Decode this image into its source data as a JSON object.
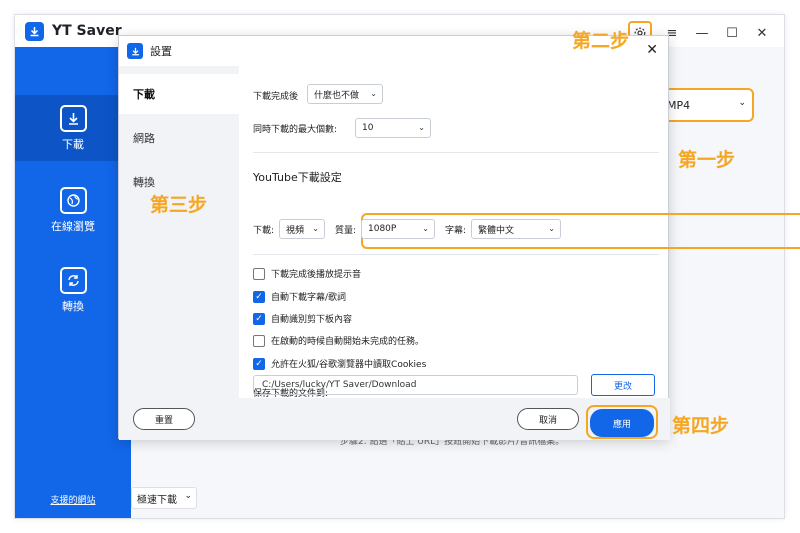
{
  "app": {
    "title": "YT Saver"
  },
  "sidebar": {
    "items": [
      {
        "label": "下載",
        "icon": "download-icon"
      },
      {
        "label": "在線瀏覽",
        "icon": "globe-icon"
      },
      {
        "label": "轉換",
        "icon": "convert-icon"
      }
    ],
    "link_label": "支援的網站"
  },
  "main": {
    "format_value": "MP4",
    "speed_value": "極速下載",
    "hint": "步驟2. 點選「貼上 URL」按鈕開始下載影片/音訊檔案。"
  },
  "dialog": {
    "title": "設置",
    "nav": [
      "下載",
      "網路",
      "轉換"
    ],
    "after_complete_label": "下載完成後",
    "after_complete_value": "什麼也不做",
    "max_label": "同時下載的最大個數:",
    "max_value": "10",
    "youtube_title": "YouTube下載設定",
    "download_label": "下載:",
    "download_value": "視頻",
    "quality_label": "質量:",
    "quality_value": "1080P",
    "subtitle_label": "字幕:",
    "subtitle_value": "繁體中文",
    "checks": [
      {
        "label": "下載完成後播放提示音",
        "checked": false
      },
      {
        "label": "自動下載字幕/歌詞",
        "checked": true
      },
      {
        "label": "自動識別剪下板內容",
        "checked": true
      },
      {
        "label": "在啟動的時候自動開始未完成的任務。",
        "checked": false
      },
      {
        "label": "允許在火狐/谷歌瀏覽器中讀取Cookies",
        "checked": true
      }
    ],
    "save_label": "保存下載的文件到:",
    "save_path": "C:/Users/lucky/YT Saver/Download",
    "change_label": "更改",
    "reset_label": "重置",
    "cancel_label": "取消",
    "apply_label": "應用"
  },
  "annotations": {
    "step1": "第一步",
    "step2": "第二步",
    "step3": "第三步",
    "step4": "第四步"
  },
  "colors": {
    "brand": "#1266e8",
    "highlight": "#f5a623"
  }
}
